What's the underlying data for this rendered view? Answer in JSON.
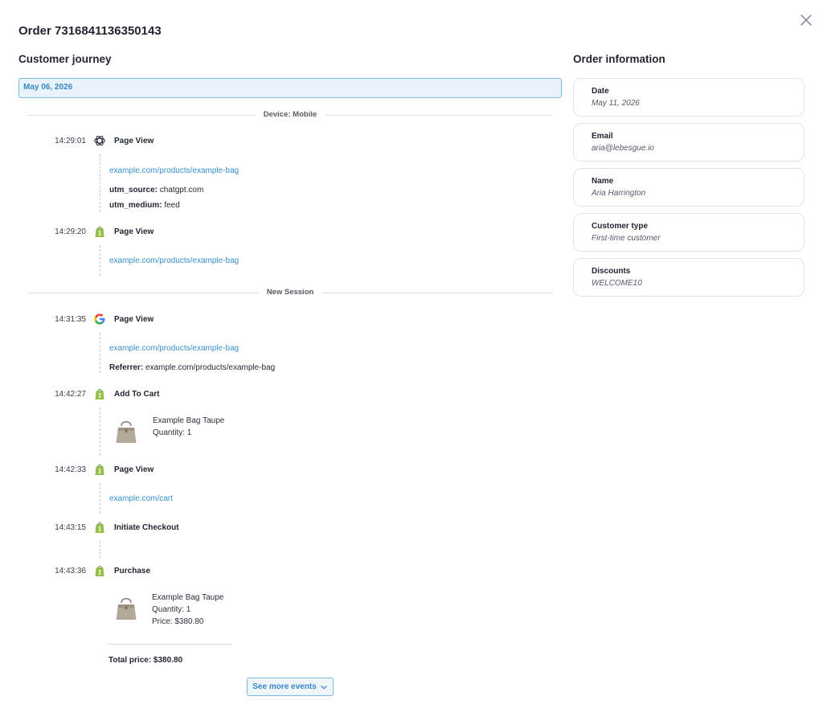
{
  "order": {
    "title": "Order 7316841136350143"
  },
  "journey": {
    "title": "Customer journey",
    "date": "May 06, 2026",
    "device_divider": "Device: Mobile",
    "session_divider": "New Session",
    "events": [
      {
        "time": "14:29:01",
        "icon": "openai-icon",
        "name": "Page View",
        "url": "example.com/products/example-bag",
        "utm_source_label": "utm_source:",
        "utm_source": "chatgpt.com",
        "utm_medium_label": "utm_medium:",
        "utm_medium": "feed"
      },
      {
        "time": "14:29:20",
        "icon": "shopify-icon",
        "name": "Page View",
        "url": "example.com/products/example-bag"
      },
      {
        "time": "14:31:35",
        "icon": "google-icon",
        "name": "Page View",
        "url": "example.com/products/example-bag",
        "referrer_label": "Referrer:",
        "referrer": "example.com/products/example-bag"
      },
      {
        "time": "14:42:27",
        "icon": "shopify-icon",
        "name": "Add To Cart",
        "product": "Example Bag Taupe",
        "quantity": "Quantity: 1"
      },
      {
        "time": "14:42:33",
        "icon": "shopify-icon",
        "name": "Page View",
        "url": "example.com/cart"
      },
      {
        "time": "14:43:15",
        "icon": "shopify-icon",
        "name": "Initiate Checkout"
      },
      {
        "time": "14:43:36",
        "icon": "shopify-icon",
        "name": "Purchase",
        "product": "Example Bag Taupe",
        "quantity": "Quantity: 1",
        "price": "Price: $380.80"
      }
    ],
    "total_price": "Total price: $380.80",
    "see_more_label": "See more events"
  },
  "order_info": {
    "title": "Order information",
    "fields": [
      {
        "label": "Date",
        "value": "May 11, 2026"
      },
      {
        "label": "Email",
        "value": "aria@lebesgue.io"
      },
      {
        "label": "Name",
        "value": "Aria Harrington"
      },
      {
        "label": "Customer type",
        "value": "First-time customer"
      },
      {
        "label": "Discounts",
        "value": "WELCOME10"
      }
    ]
  },
  "colors": {
    "accent": "#3a86c4",
    "link": "#3a8fcb",
    "shopify": "#95bf47",
    "date_bar_bg": "#e8f3fb"
  }
}
